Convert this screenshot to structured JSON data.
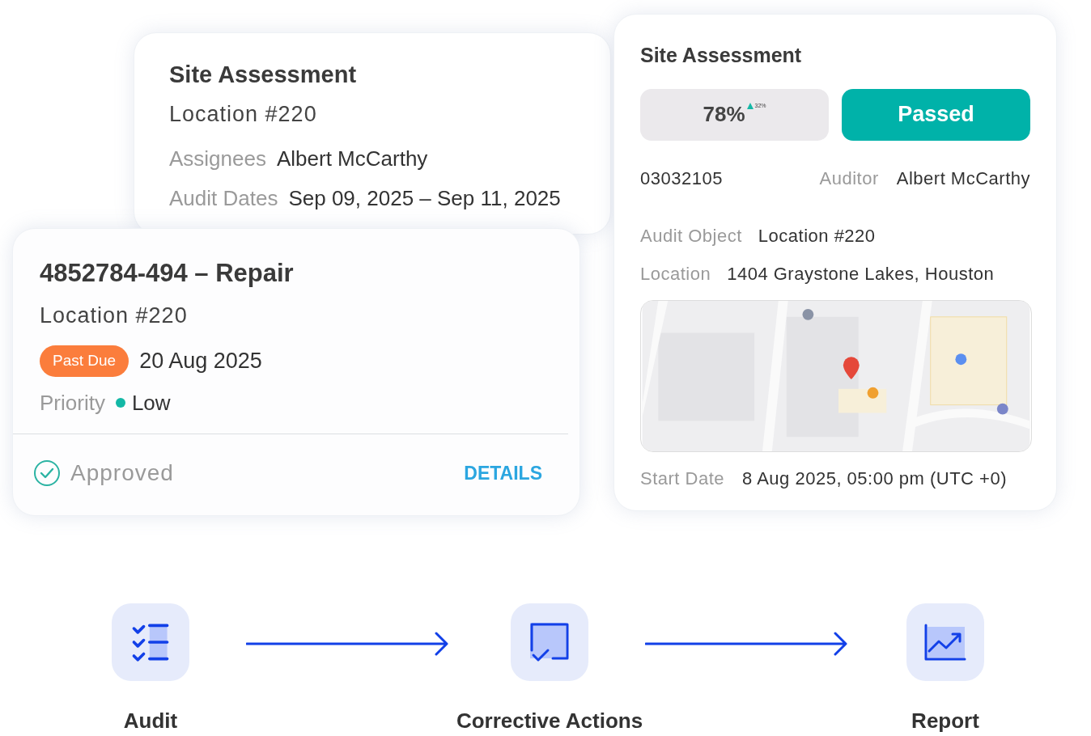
{
  "back_card": {
    "title": "Site Assessment",
    "subtitle": "Location #220",
    "fields": [
      {
        "label": "Assignees",
        "value": "Albert McCarthy"
      },
      {
        "label": "Audit Dates",
        "value": "Sep 09, 2025 – Sep 11, 2025"
      }
    ]
  },
  "task_card": {
    "title": "4852784-494 – Repair",
    "subtitle": "Location #220",
    "badge": "Past Due",
    "date": "20 Aug 2025",
    "priority_label": "Priority",
    "priority": {
      "text": "Low",
      "color": "#14b8a6"
    },
    "status": {
      "text": "Approved",
      "checked": true
    },
    "link": "DETAILS"
  },
  "assessment_card": {
    "title": "Site Assessment",
    "score": "78%",
    "change": "32%",
    "result": "Passed",
    "number": "03032105",
    "auditor_label": "Auditor",
    "auditor": "Albert McCarthy",
    "fields": [
      {
        "label": "Audit Object",
        "value": "Location #220"
      },
      {
        "label": "Location",
        "value": "1404 Graystone Lakes, Houston"
      }
    ],
    "start_label": "Start Date",
    "start": "8 Aug 2025, 05:00 pm (UTC +0)"
  },
  "flow": [
    {
      "kind": "checklist",
      "label": "Audit"
    },
    {
      "kind": "task",
      "label": "Corrective Actions"
    },
    {
      "kind": "chart",
      "label": "Report"
    }
  ]
}
